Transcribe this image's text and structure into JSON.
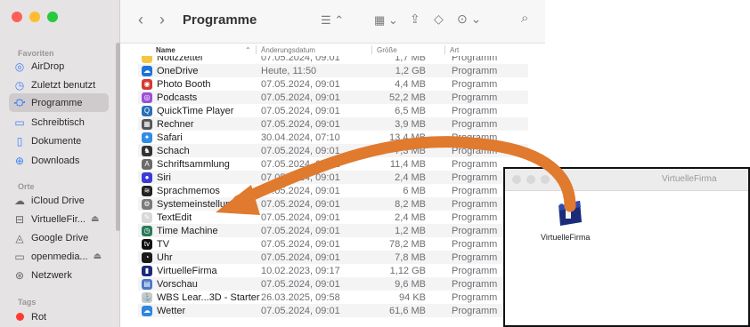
{
  "finder": {
    "title": "Programme",
    "sidebar": {
      "favorites_label": "Favoriten",
      "places_label": "Orte",
      "tags_label": "Tags",
      "favorites": [
        {
          "label": "AirDrop",
          "icon": "airdrop-icon"
        },
        {
          "label": "Zuletzt benutzt",
          "icon": "clock-icon"
        },
        {
          "label": "Programme",
          "icon": "apps-icon",
          "selected": true
        },
        {
          "label": "Schreibtisch",
          "icon": "desktop-icon"
        },
        {
          "label": "Dokumente",
          "icon": "document-icon"
        },
        {
          "label": "Downloads",
          "icon": "download-icon"
        }
      ],
      "places": [
        {
          "label": "iCloud Drive",
          "icon": "cloud-icon"
        },
        {
          "label": "VirtuelleFir...",
          "icon": "drive-icon",
          "eject": true
        },
        {
          "label": "Google Drive",
          "icon": "drive-icon"
        },
        {
          "label": "openmedia...",
          "icon": "display-icon",
          "eject": true
        },
        {
          "label": "Netzwerk",
          "icon": "network-icon"
        }
      ],
      "tags": [
        {
          "label": "Rot",
          "color": "#ff3b30"
        }
      ]
    },
    "columns": {
      "name": "Name",
      "date": "Änderungsdatum",
      "size": "Größe",
      "kind": "Art"
    },
    "rows": [
      {
        "name": "Notizzettel",
        "date": "07.05.2024, 09:01",
        "size": "1,7 MB",
        "kind": "Programm",
        "color": "#f5c542",
        "glyph": ""
      },
      {
        "name": "OneDrive",
        "date": "Heute, 11:50",
        "size": "1,2 GB",
        "kind": "Programm",
        "color": "#1e73d8",
        "glyph": "☁"
      },
      {
        "name": "Photo Booth",
        "date": "07.05.2024, 09:01",
        "size": "4,4 MB",
        "kind": "Programm",
        "color": "#d23a2f",
        "glyph": "◉"
      },
      {
        "name": "Podcasts",
        "date": "07.05.2024, 09:01",
        "size": "52,2 MB",
        "kind": "Programm",
        "color": "#9b4fd8",
        "glyph": "◎"
      },
      {
        "name": "QuickTime Player",
        "date": "07.05.2024, 09:01",
        "size": "6,5 MB",
        "kind": "Programm",
        "color": "#2a6fb5",
        "glyph": "Q"
      },
      {
        "name": "Rechner",
        "date": "07.05.2024, 09:01",
        "size": "3,9 MB",
        "kind": "Programm",
        "color": "#555555",
        "glyph": "▦"
      },
      {
        "name": "Safari",
        "date": "30.04.2024, 07:10",
        "size": "13,4 MB",
        "kind": "Programm",
        "color": "#2e8de6",
        "glyph": "✦"
      },
      {
        "name": "Schach",
        "date": "07.05.2024, 09:01",
        "size": "7,3 MB",
        "kind": "Programm",
        "color": "#333333",
        "glyph": "♞"
      },
      {
        "name": "Schriftsammlung",
        "date": "07.05.2024, 09:01",
        "size": "11,4 MB",
        "kind": "Programm",
        "color": "#6a6a6a",
        "glyph": "A"
      },
      {
        "name": "Siri",
        "date": "07.05.2024, 09:01",
        "size": "2,4 MB",
        "kind": "Programm",
        "color": "#3a3ad8",
        "glyph": "●"
      },
      {
        "name": "Sprachmemos",
        "date": "07.05.2024, 09:01",
        "size": "6 MB",
        "kind": "Programm",
        "color": "#222222",
        "glyph": "≋"
      },
      {
        "name": "Systemeinstellungen",
        "date": "07.05.2024, 09:01",
        "size": "8,2 MB",
        "kind": "Programm",
        "color": "#7a7a7a",
        "glyph": "⚙"
      },
      {
        "name": "TextEdit",
        "date": "07.05.2024, 09:01",
        "size": "2,4 MB",
        "kind": "Programm",
        "color": "#d8d8d8",
        "glyph": "✎"
      },
      {
        "name": "Time Machine",
        "date": "07.05.2024, 09:01",
        "size": "1,2 MB",
        "kind": "Programm",
        "color": "#2b7a5a",
        "glyph": "◷"
      },
      {
        "name": "TV",
        "date": "07.05.2024, 09:01",
        "size": "78,2 MB",
        "kind": "Programm",
        "color": "#111111",
        "glyph": "tv"
      },
      {
        "name": "Uhr",
        "date": "07.05.2024, 09:01",
        "size": "7,8 MB",
        "kind": "Programm",
        "color": "#1a1a1a",
        "glyph": "◔"
      },
      {
        "name": "VirtuelleFirma",
        "date": "10.02.2023, 09:17",
        "size": "1,12 GB",
        "kind": "Programm",
        "color": "#1b2b7a",
        "glyph": "▮"
      },
      {
        "name": "Vorschau",
        "date": "07.05.2024, 09:01",
        "size": "9,6 MB",
        "kind": "Programm",
        "color": "#4a78c8",
        "glyph": "▤"
      },
      {
        "name": "WBS Lear...3D - Starter",
        "date": "26.03.2025, 09:58",
        "size": "94 KB",
        "kind": "Programm",
        "color": "#c9c9c9",
        "glyph": "⚓"
      },
      {
        "name": "Wetter",
        "date": "07.05.2024, 09:01",
        "size": "61,6 MB",
        "kind": "Programm",
        "color": "#2d86e0",
        "glyph": "☁"
      }
    ]
  },
  "second_window": {
    "title": "VirtuelleFirma",
    "app_label": "VirtuelleFirma"
  },
  "accent_arrow_color": "#e07a2e"
}
